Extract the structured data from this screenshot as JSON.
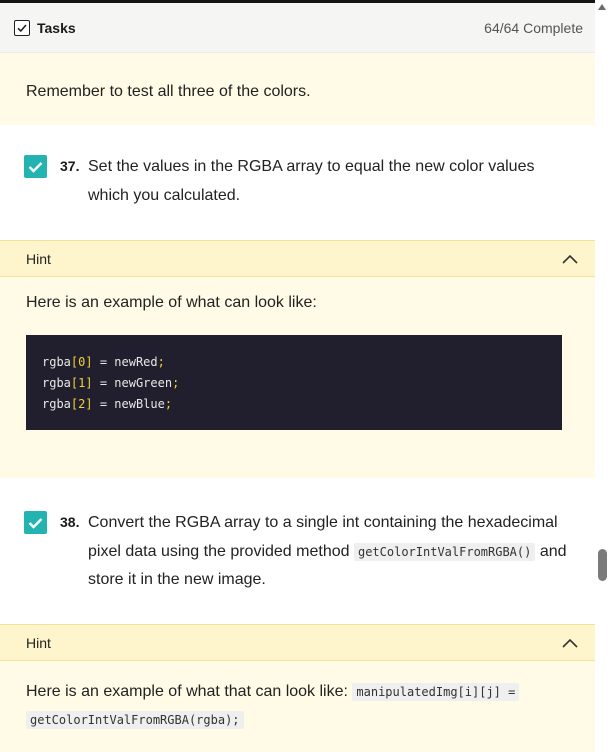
{
  "header": {
    "title": "Tasks",
    "status": "64/64 Complete"
  },
  "note": {
    "text": "Remember to test all three of the colors."
  },
  "tasks": [
    {
      "number": "37.",
      "text": "Set the values in the RGBA array to equal the new color values which you calculated.",
      "hint": {
        "label": "Hint",
        "intro": "Here is an example of what can look like:",
        "code": [
          {
            "var": "rgba",
            "idx": "[0]",
            "eq": " = ",
            "val": "newRed",
            "semi": ";"
          },
          {
            "var": "rgba",
            "idx": "[1]",
            "eq": " = ",
            "val": "newGreen",
            "semi": ";"
          },
          {
            "var": "rgba",
            "idx": "[2]",
            "eq": " = ",
            "val": "newBlue",
            "semi": ";"
          }
        ]
      }
    },
    {
      "number": "38.",
      "text_before": "Convert the RGBA array to a single int containing the hexadecimal pixel data using the provided method",
      "code_inline": "getColorIntValFromRGBA()",
      "text_after": "and store it in the new image.",
      "hint": {
        "label": "Hint",
        "intro": "Here is an example of what that can look like:",
        "code_line1": "manipulatedImg[i][j] =",
        "code_line2": "getColorIntValFromRGBA(rgba);"
      }
    }
  ],
  "colors": {
    "accent": "#23b3b0",
    "hint_bg": "#fff5cc",
    "note_bg": "#fffbe6",
    "code_bg": "#211f2d"
  },
  "icons": [
    "checkbox-icon",
    "check-icon",
    "chevron-up-icon",
    "scroll-up-arrow-icon"
  ]
}
